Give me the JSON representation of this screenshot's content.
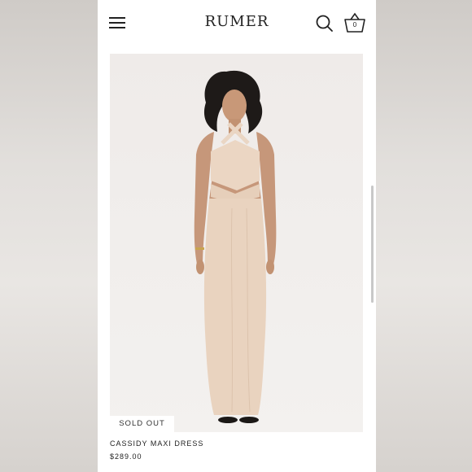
{
  "header": {
    "logo": "RUMER",
    "cart_count": "0",
    "icons": [
      "hamburger-menu-icon",
      "search-icon",
      "basket-icon"
    ]
  },
  "product": {
    "badge": "SOLD OUT",
    "name": "CASSIDY MAXI DRESS",
    "price": "$289.00",
    "image_subject": "model wearing beige halter cut-out maxi dress"
  },
  "colors": {
    "page_bg": "#ffffff",
    "image_bg": "#f1eeec",
    "dress": "#e9d3bf",
    "text": "#222222"
  }
}
